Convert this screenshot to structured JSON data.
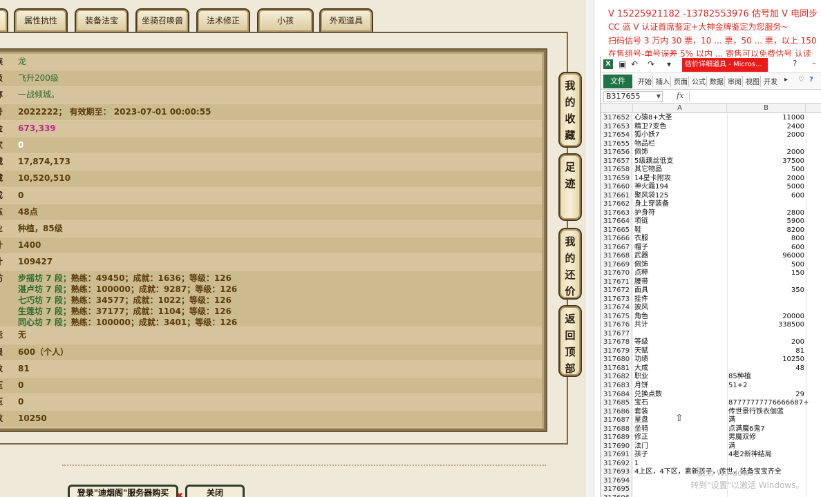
{
  "game": {
    "tabs": [
      {
        "label": "",
        "active": true
      },
      {
        "label": "属性抗性"
      },
      {
        "label": "装备法宝"
      },
      {
        "label": "坐骑召唤兽"
      },
      {
        "label": "法术修正"
      },
      {
        "label": "小孩"
      },
      {
        "label": "外观道具"
      }
    ],
    "rows": [
      {
        "label": "族",
        "value": "龙",
        "color": "green"
      },
      {
        "label": "级",
        "value": "飞升200级",
        "color": "green"
      },
      {
        "label": "称",
        "value": "一战倾城。",
        "color": "green"
      },
      {
        "label": "号",
        "value": "2022222； 有效期至： 2023-07-01 00:00:55",
        "color": "brown"
      },
      {
        "label": "金",
        "value": "673,339",
        "color": "pink"
      },
      {
        "label": "欢",
        "value": "0",
        "color": "white"
      },
      {
        "label": "贼",
        "value": "17,874,173",
        "color": "brown"
      },
      {
        "label": "贼",
        "value": "10,520,510",
        "color": "brown"
      },
      {
        "label": "成",
        "value": "0",
        "color": "brown"
      },
      {
        "label": "炼",
        "value": "48点",
        "color": "brown"
      },
      {
        "label": "业",
        "value": "种植，85级",
        "color": "brown"
      },
      {
        "label": "计",
        "value": "1400",
        "color": "brown"
      },
      {
        "label": "计",
        "value": "109427",
        "color": "brown"
      }
    ],
    "fang_label": "坊",
    "fang": [
      {
        "name": "步摇坊 7 段；",
        "detail": "熟练：49450；成就：1636；等级：126"
      },
      {
        "name": "湛卢坊 7 段；",
        "detail": "熟练：100000；成就：9287；等级：126"
      },
      {
        "name": "七巧坊 7 段；",
        "detail": "熟练：34577；成就：1022；等级：126"
      },
      {
        "name": "生莲坊 7 段；",
        "detail": "熟练：37177；成就：1104；等级：126"
      },
      {
        "name": "同心坊 7 段；",
        "detail": "熟练：100000；成就：3401；等级：126"
      }
    ],
    "rows2": [
      {
        "label": "能",
        "value": "无",
        "color": "brown"
      },
      {
        "label": "限",
        "value": "600（个人）",
        "color": "brown"
      },
      {
        "label": "数",
        "value": "81",
        "color": "brown"
      },
      {
        "label": "压",
        "value": "0",
        "color": "brown"
      },
      {
        "label": "压",
        "value": "0",
        "color": "brown"
      },
      {
        "label": "数",
        "value": "10250",
        "color": "brown"
      }
    ],
    "side_buttons": [
      "我的收藏",
      "足迹",
      "我的还价",
      "返回顶部"
    ],
    "bottom_buttons": [
      "登录\"迪烟阁\"服务器购买",
      "关闭"
    ]
  },
  "promo": [
    "V 15225921182 -13782553976 估号加 V 电同步",
    "CC 蓝 V 认证首席鉴定+大神金牌鉴定为您服务~",
    "扫码估号 3 万内 30 票，10 ... 票，50 ... 票，以上 150",
    "在售组号-单号误差 5% 以内 ... 寄售可以免费估号 认读"
  ],
  "excel": {
    "title_doc": "估价详细道具 - Micros...",
    "ribbon_tabs": [
      "文件",
      "开始",
      "插入",
      "页面",
      "公式",
      "数据",
      "审阅",
      "视图",
      "开发"
    ],
    "name_box": "B317655",
    "fx": "fx",
    "col_a": "A",
    "col_b": "B",
    "rows": [
      {
        "n": "317652",
        "a": "心猿8+大圣",
        "b": "11000"
      },
      {
        "n": "317653",
        "a": "精卫7变色",
        "b": "2400"
      },
      {
        "n": "317654",
        "a": "狐小妖7",
        "b": "2000"
      },
      {
        "n": "317655",
        "a": "物品栏",
        "b": ""
      },
      {
        "n": "317656",
        "a": "佩饰",
        "b": "2000"
      },
      {
        "n": "317657",
        "a": "5级藕丝低支",
        "b": "37500"
      },
      {
        "n": "317658",
        "a": "其它物品",
        "b": "500"
      },
      {
        "n": "317659",
        "a": "14星卡附攻",
        "b": "2000"
      },
      {
        "n": "317660",
        "a": "神火霜194",
        "b": "5000"
      },
      {
        "n": "317661",
        "a": "聚风袋125",
        "b": "600"
      },
      {
        "n": "317662",
        "a": "身上穿装备",
        "b": ""
      },
      {
        "n": "317663",
        "a": "护身符",
        "b": "2800"
      },
      {
        "n": "317664",
        "a": "项链",
        "b": "5900"
      },
      {
        "n": "317665",
        "a": "鞋",
        "b": "8200"
      },
      {
        "n": "317666",
        "a": "衣服",
        "b": "800"
      },
      {
        "n": "317667",
        "a": "帽子",
        "b": "600"
      },
      {
        "n": "317668",
        "a": "武器",
        "b": "96000"
      },
      {
        "n": "317669",
        "a": "佩饰",
        "b": "500"
      },
      {
        "n": "317670",
        "a": "点粹",
        "b": "150"
      },
      {
        "n": "317671",
        "a": "腰带",
        "b": ""
      },
      {
        "n": "317672",
        "a": "面具",
        "b": "350"
      },
      {
        "n": "317673",
        "a": "挂件",
        "b": ""
      },
      {
        "n": "317674",
        "a": "披风",
        "b": ""
      },
      {
        "n": "317675",
        "a": "角色",
        "b": "20000"
      },
      {
        "n": "317676",
        "a": "共计",
        "b": "338500"
      },
      {
        "n": "317677",
        "a": "",
        "b": ""
      },
      {
        "n": "317678",
        "a": "等级",
        "b": "200"
      },
      {
        "n": "317679",
        "a": "天赋",
        "b": "81"
      },
      {
        "n": "317680",
        "a": "功绩",
        "b": "10250"
      },
      {
        "n": "317681",
        "a": "大成",
        "b": "48"
      },
      {
        "n": "317682",
        "a": "职业",
        "b": "85种植",
        "left": true
      },
      {
        "n": "317683",
        "a": "月饼",
        "b": "51+2",
        "left": true
      },
      {
        "n": "317684",
        "a": "兑换点数",
        "b": "29"
      },
      {
        "n": "317685",
        "a": "宝石",
        "b": "87777777776666687+",
        "left": true
      },
      {
        "n": "317686",
        "a": "套装",
        "b": "传世景行铁衣伽蓝",
        "left": true
      },
      {
        "n": "317687",
        "a": "星盘",
        "b": "满",
        "left": true
      },
      {
        "n": "317688",
        "a": "坐骑",
        "b": "点满魔6鬼7",
        "left": true
      },
      {
        "n": "317689",
        "a": "修正",
        "b": "男魔双修",
        "left": true
      },
      {
        "n": "317690",
        "a": "法门",
        "b": "满",
        "left": true
      },
      {
        "n": "317691",
        "a": "孩子",
        "b": "4老2新神结局",
        "left": true
      },
      {
        "n": "317692",
        "a": "1",
        "b": ""
      },
      {
        "n": "317693",
        "a": "4上区，4下区，素新孩子，传世，装备宝宝齐全",
        "b": ""
      },
      {
        "n": "317694",
        "a": "",
        "b": ""
      },
      {
        "n": "317695",
        "a": "",
        "b": ""
      },
      {
        "n": "317696",
        "a": "",
        "b": ""
      }
    ],
    "watermark1": "激活 Windows",
    "watermark2": "转到\"设置\"以激活 Windows。"
  }
}
